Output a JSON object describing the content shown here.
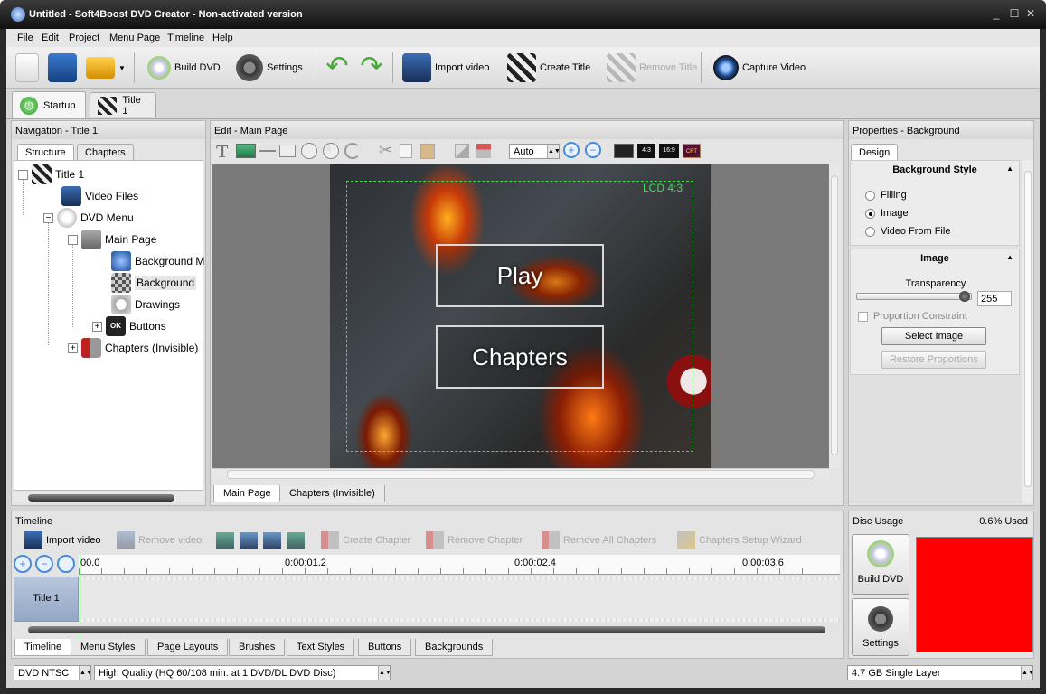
{
  "window": {
    "title": "Untitled - Soft4Boost DVD Creator - Non-activated version"
  },
  "menu": [
    "File",
    "Edit",
    "Project",
    "Menu Page",
    "Timeline",
    "Help"
  ],
  "toolbar": {
    "build_dvd": "Build DVD",
    "settings": "Settings",
    "import_video": "Import video",
    "create_title": "Create Title",
    "remove_title": "Remove Title",
    "capture_video": "Capture Video"
  },
  "tabs": {
    "startup": "Startup",
    "title1": "Title 1"
  },
  "nav": {
    "header": "Navigation - Title 1",
    "tab_structure": "Structure",
    "tab_chapters": "Chapters",
    "tree": [
      "Title 1",
      "Video Files",
      "DVD Menu",
      "Main Page",
      "Background M",
      "Background",
      "Drawings",
      "Buttons",
      "Chapters (Invisible)"
    ]
  },
  "edit": {
    "header": "Edit - Main Page",
    "zoom": "Auto",
    "canvas_label": "LCD 4:3",
    "btn_play": "Play",
    "btn_chapters": "Chapters",
    "ratio1": "4:3",
    "ratio2": "16:9",
    "crt": "CRT",
    "tab_main": "Main Page",
    "tab_chapters": "Chapters (Invisible)"
  },
  "props": {
    "header": "Properties - Background",
    "tab_design": "Design",
    "bg_style": "Background Style",
    "opt_filling": "Filling",
    "opt_image": "Image",
    "opt_video": "Video From File",
    "image_section": "Image",
    "transparency": "Transparency",
    "transparency_value": "255",
    "proportion": "Proportion Constraint",
    "select_image": "Select Image",
    "restore": "Restore Proportions"
  },
  "timeline": {
    "header": "Timeline",
    "import_video": "Import video",
    "remove_video": "Remove video",
    "create_chapter": "Create Chapter",
    "remove_chapter": "Remove Chapter",
    "remove_all": "Remove All Chapters",
    "wizard": "Chapters Setup Wizard",
    "ticks": [
      "00.0",
      "0:00:01.2",
      "0:00:02.4",
      "0:00:03.6"
    ],
    "track": "Title 1",
    "tabs": [
      "Timeline",
      "Menu Styles",
      "Page Layouts",
      "Brushes",
      "Text Styles",
      "Buttons",
      "Backgrounds"
    ]
  },
  "disc": {
    "header": "Disc Usage",
    "used": "0.6% Used",
    "build_dvd": "Build DVD",
    "settings": "Settings",
    "usage_color": "#ff0000"
  },
  "status": {
    "format": "DVD NTSC",
    "quality": "High Quality (HQ 60/108 min. at 1 DVD/DL DVD Disc)",
    "disc": "4.7 GB Single Layer"
  },
  "colors": {
    "accent_green": "#3ca03c",
    "accent_blue": "#1b5fa8",
    "canvas_bg": "#7a7a7a"
  }
}
